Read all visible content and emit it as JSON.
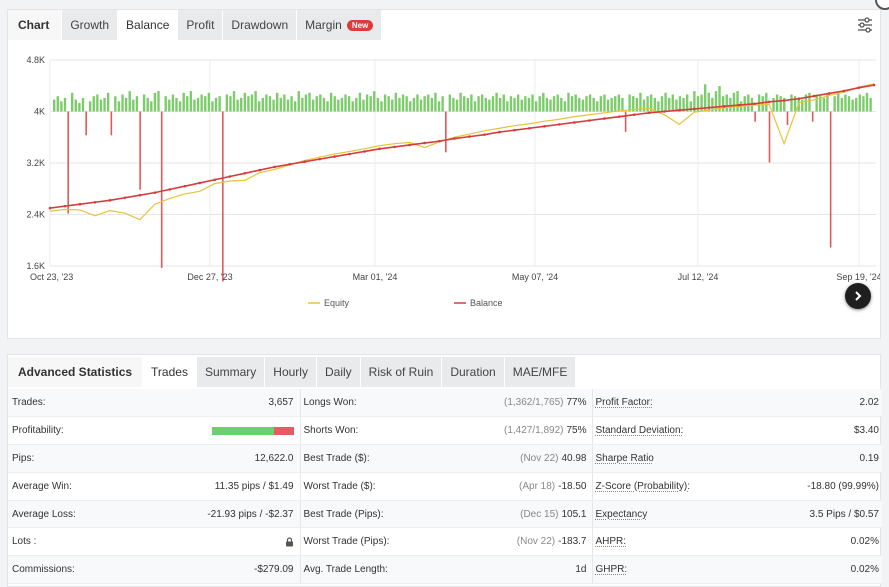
{
  "chart_tabs": {
    "head": "Chart",
    "items": [
      "Growth",
      "Balance",
      "Profit",
      "Drawdown",
      "Margin"
    ],
    "active": "Balance",
    "new_badge": "New"
  },
  "chart_data": {
    "type": "line",
    "title": "",
    "y_ticks": [
      "4.8K",
      "4K",
      "3.2K",
      "2.4K",
      "1.6K"
    ],
    "x_ticks": [
      "Oct 23, '23",
      "Dec 27, '23",
      "Mar 01, '24",
      "May 07, '24",
      "Jul 12, '24",
      "Sep 19, '24"
    ],
    "ylim": [
      1600,
      4800
    ],
    "grid": true,
    "legend_position": "bottom-center",
    "series": [
      {
        "name": "Equity",
        "color": "#e8c33a",
        "values": [
          2450,
          2480,
          2470,
          2380,
          2460,
          2420,
          2320,
          2560,
          2650,
          2720,
          2760,
          2880,
          2920,
          2930,
          3050,
          3100,
          3170,
          3240,
          3290,
          3340,
          3380,
          3420,
          3470,
          3500,
          3520,
          3440,
          3530,
          3600,
          3650,
          3700,
          3740,
          3780,
          3810,
          3850,
          3880,
          3920,
          3950,
          3980,
          4010,
          4030,
          4050,
          3950,
          3800,
          3990,
          4020,
          4060,
          4080,
          4100,
          4110,
          3500,
          4140,
          4180,
          4250,
          4300,
          4380,
          4430
        ]
      },
      {
        "name": "Balance",
        "color": "#d63c3c",
        "values": [
          2500,
          2530,
          2560,
          2590,
          2620,
          2660,
          2700,
          2740,
          2790,
          2840,
          2890,
          2940,
          2990,
          3040,
          3090,
          3140,
          3180,
          3220,
          3260,
          3300,
          3340,
          3380,
          3420,
          3450,
          3480,
          3510,
          3540,
          3580,
          3610,
          3640,
          3680,
          3710,
          3740,
          3770,
          3800,
          3830,
          3860,
          3890,
          3920,
          3950,
          3980,
          4000,
          4020,
          4040,
          4060,
          4080,
          4100,
          4120,
          4150,
          4170,
          4200,
          4240,
          4280,
          4320,
          4370,
          4410
        ]
      }
    ],
    "daily_profit_bars": {
      "name": "daily result",
      "positive_color": "#7dcc6b",
      "negative_color": "#e05a5a",
      "values": [
        0.35,
        0.45,
        0.3,
        0.4,
        -3.0,
        0.55,
        0.35,
        0.25,
        0.4,
        -0.7,
        0.3,
        0.45,
        0.5,
        0.35,
        0.4,
        0.55,
        -0.7,
        0.45,
        0.3,
        0.5,
        0.4,
        0.6,
        0.35,
        0.45,
        -2.3,
        0.5,
        0.4,
        0.3,
        0.55,
        0.6,
        -4.6,
        0.45,
        0.35,
        0.5,
        0.4,
        0.3,
        0.55,
        0.45,
        0.6,
        0.35,
        0.4,
        0.5,
        0.45,
        0.55,
        0.3,
        0.4,
        0.45,
        -5.0,
        0.5,
        0.45,
        0.6,
        0.35,
        0.4,
        0.55,
        0.45,
        0.5,
        0.6,
        0.3,
        0.4,
        0.5,
        0.45,
        0.35,
        0.55,
        0.4,
        0.5,
        0.35,
        0.45,
        0.3,
        0.6,
        0.4,
        0.5,
        0.55,
        0.35,
        0.45,
        0.5,
        0.4,
        0.3,
        0.55,
        0.45,
        0.35,
        0.4,
        0.5,
        0.45,
        0.3,
        0.4,
        0.55,
        0.35,
        0.5,
        0.45,
        0.6,
        0.4,
        0.3,
        0.5,
        0.45,
        0.35,
        0.55,
        0.4,
        0.5,
        0.45,
        0.3,
        0.4,
        0.5,
        0.35,
        0.45,
        0.5,
        0.4,
        0.55,
        0.3,
        0.45,
        -1.2,
        0.5,
        0.4,
        0.35,
        0.55,
        0.45,
        0.4,
        0.5,
        0.3,
        0.45,
        0.5,
        0.4,
        0.35,
        0.45,
        0.55,
        0.4,
        0.5,
        0.3,
        0.45,
        0.4,
        0.5,
        0.35,
        0.45,
        0.4,
        0.5,
        0.3,
        0.45,
        0.55,
        0.4,
        0.35,
        0.45,
        0.5,
        0.4,
        0.3,
        0.55,
        0.45,
        0.5,
        0.4,
        0.35,
        0.45,
        0.5,
        0.4,
        0.3,
        0.45,
        0.5,
        0.35,
        0.4,
        0.45,
        0.5,
        0.4,
        -0.6,
        0.5,
        0.45,
        0.4,
        0.55,
        0.35,
        0.45,
        0.5,
        0.4,
        0.3,
        0.45,
        0.55,
        0.4,
        0.5,
        0.35,
        0.45,
        0.4,
        0.5,
        0.3,
        0.6,
        0.45,
        0.5,
        0.8,
        0.55,
        0.4,
        0.6,
        0.75,
        0.45,
        0.5,
        0.4,
        0.55,
        0.6,
        0.3,
        0.45,
        0.5,
        0.4,
        -0.3,
        0.5,
        0.45,
        0.55,
        -1.5,
        0.4,
        0.5,
        0.45,
        0.4,
        -0.4,
        0.5,
        0.45,
        0.4,
        0.35,
        0.5,
        0.55,
        -0.3,
        0.5,
        0.45,
        0.4,
        0.5,
        -4.0,
        0.45,
        0.55,
        0.4,
        0.5,
        0.45,
        0.35,
        0.4,
        0.5,
        0.45,
        0.55,
        0.4
      ]
    },
    "legend": [
      "Equity",
      "Balance"
    ]
  },
  "stats_tabs": {
    "head": "Advanced Statistics",
    "items": [
      "Trades",
      "Summary",
      "Hourly",
      "Daily",
      "Risk of Ruin",
      "Duration",
      "MAE/MFE"
    ],
    "active": "Trades"
  },
  "stats": {
    "rows": [
      {
        "l1": "Trades:",
        "v1": "3,657",
        "l2": "Longs Won:",
        "p2": "(1,362/1,765)",
        "v2": "77%",
        "l3": "Profit Factor:",
        "v3": "2.02"
      },
      {
        "l1": "Profitability:",
        "v1": "",
        "l2": "Shorts Won:",
        "p2": "(1,427/1,892)",
        "v2": "75%",
        "l3": "Standard Deviation:",
        "v3": "$3.40"
      },
      {
        "l1": "Pips:",
        "v1": "12,622.0",
        "l2": "Best Trade ($):",
        "p2": "(Nov 22)",
        "v2": "40.98",
        "l3": "Sharpe Ratio",
        "v3": "0.19"
      },
      {
        "l1": "Average Win:",
        "v1": "11.35 pips / $1.49",
        "l2": "Worst Trade ($):",
        "p2": "(Apr 18)",
        "v2": "-18.50",
        "l3": "Z-Score (Probability):",
        "v3": "-18.80 (99.99%)"
      },
      {
        "l1": "Average Loss:",
        "v1": "-21.93 pips / -$2.37",
        "l2": "Best Trade (Pips):",
        "p2": "(Dec 15)",
        "v2": "105.1",
        "l3": "Expectancy",
        "v3": "3.5 Pips / $0.57"
      },
      {
        "l1": "Lots :",
        "v1": "",
        "l2": "Worst Trade (Pips):",
        "p2": "(Nov 22)",
        "v2": "-183.7",
        "l3": "AHPR:",
        "v3": "0.02%"
      },
      {
        "l1": "Commissions:",
        "v1": "-$279.09",
        "l2": "Avg. Trade Length:",
        "p2": "",
        "v2": "1d",
        "l3": "GHPR:",
        "v3": "0.02%"
      }
    ],
    "profitability_win_fraction": 0.76
  },
  "icons": {
    "settings": "sliders-icon",
    "next": "chevron-right-icon",
    "lots": "lock-icon"
  }
}
